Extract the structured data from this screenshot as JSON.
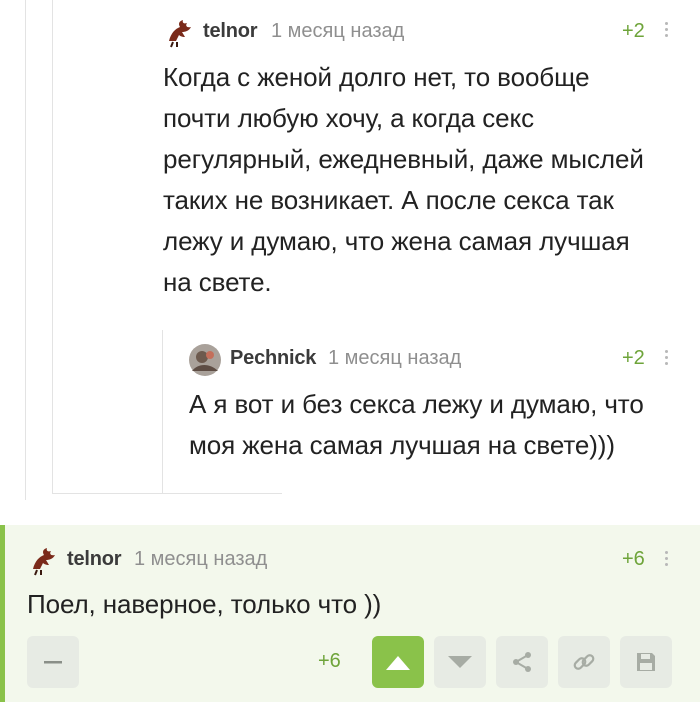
{
  "comments": [
    {
      "author": "telnor",
      "time": "1 месяц назад",
      "rating": "+2",
      "avatar_icon": "dragon-avatar-icon",
      "lines": [
        "Когда с женой долго нет, то вообще",
        "почти любую хочу, а когда секс",
        "регулярный, ежедневный, даже мыслей",
        "таких не возникает. А после секса так",
        "лежу и думаю, что жена самая лучшая",
        "на свете."
      ]
    },
    {
      "author": "Pechnick",
      "time": "1 месяц назад",
      "rating": "+2",
      "avatar_icon": "photo-avatar-icon",
      "lines": [
        "А я вот и без секса лежу и думаю, что",
        "моя жена самая лучшая на свете)))"
      ]
    },
    {
      "author": "telnor",
      "time": "1 месяц назад",
      "rating": "+6",
      "avatar_icon": "dragon-avatar-icon",
      "lines": [
        "Поел, наверное, только что ))"
      ]
    }
  ],
  "actions": {
    "collapse_icon": "minus-icon",
    "rating": "+6",
    "vote_up_icon": "arrow-up-icon",
    "vote_down_icon": "arrow-down-icon",
    "share_icon": "share-icon",
    "link_icon": "link-icon",
    "save_icon": "save-icon"
  },
  "colors": {
    "accent_green": "#8ac24a",
    "rating_green": "#6ea43a",
    "highlight_bg": "#f3f8ec"
  }
}
